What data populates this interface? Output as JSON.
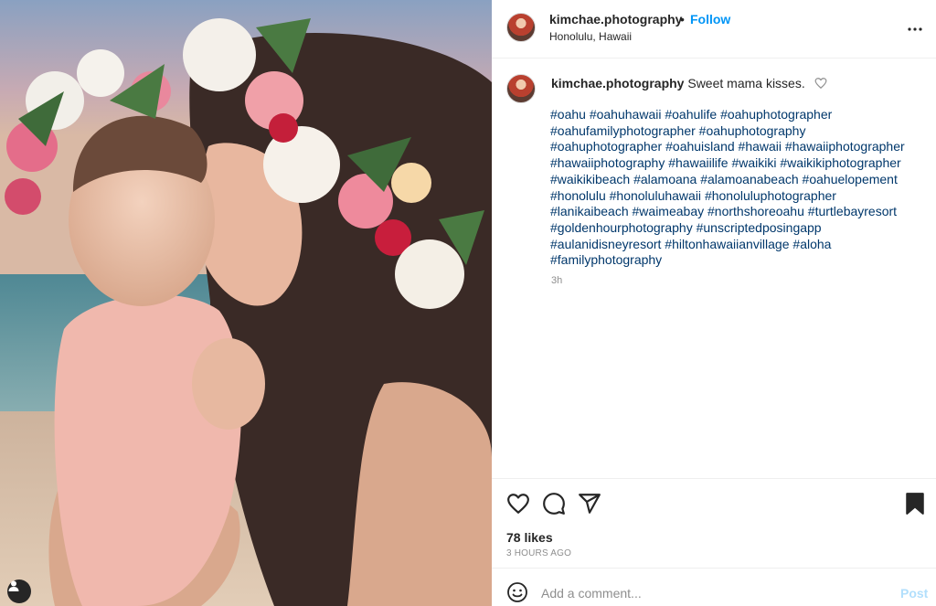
{
  "post": {
    "username": "kimchae.photography",
    "separator": "•",
    "follow_label": "Follow",
    "location": "Honolulu, Hawaii"
  },
  "caption": {
    "username": "kimchae.photography",
    "text": "Sweet mama kisses.",
    "hashtags": [
      "#oahu",
      "#oahuhawaii",
      "#oahulife",
      "#oahuphotographer",
      "#oahufamilyphotographer",
      "#oahuphotography",
      "#oahuphotographer",
      "#oahuisland",
      "#hawaii",
      "#hawaiiphotographer",
      "#hawaiiphotography",
      "#hawaiilife",
      "#waikiki",
      "#waikikiphotographer",
      "#waikikibeach",
      "#alamoana",
      "#alamoanabeach",
      "#oahuelopement",
      "#honolulu",
      "#honoluluhawaii",
      "#honoluluphotographer",
      "#lanikaibeach",
      "#waimeabay",
      "#northshoreoahu",
      "#turtlebayresort",
      "#goldenhourphotography",
      "#unscriptedposingapp",
      "#aulanidisneyresort",
      "#hiltonhawaiianvillage",
      "#aloha",
      "#familyphotography"
    ],
    "age": "3h"
  },
  "engagement": {
    "likes": "78 likes",
    "time_ago": "3 HOURS AGO"
  },
  "comment": {
    "placeholder": "Add a comment...",
    "post_label": "Post"
  },
  "icons": {
    "like": "heart-icon",
    "comment": "comment-bubble-icon",
    "share": "paper-plane-icon",
    "save": "bookmark-icon",
    "more": "more-horizontal-icon",
    "emoji": "smiley-icon",
    "tags": "user-tag-icon"
  },
  "colors": {
    "follow": "#0095f6",
    "hashtag": "#00376b",
    "muted": "#8e8e8e",
    "post_disabled": "#b2dffc"
  }
}
